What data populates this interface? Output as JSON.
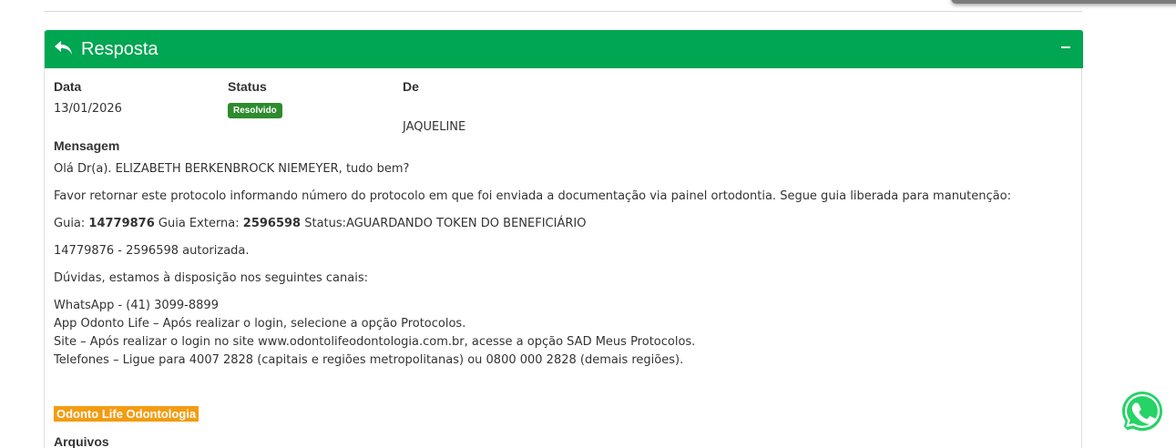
{
  "panel": {
    "title": "Resposta",
    "collapse_label": "−"
  },
  "fields": {
    "date_label": "Data",
    "date_value": "13/01/2026",
    "status_label": "Status",
    "status_value": "Resolvido",
    "from_label": "De",
    "from_value": "JAQUELINE"
  },
  "message": {
    "label": "Mensagem",
    "greeting": "Olá Dr(a). ELIZABETH BERKENBROCK NIEMEYER, tudo bem?",
    "request": "Favor retornar este protocolo informando número do protocolo em que foi enviada a documentação via painel ortodontia. Segue guia liberada para manutenção:",
    "guide_prefix": "Guia: ",
    "guide_number": "14779876",
    "external_prefix": " Guia Externa: ",
    "external_number": "2596598",
    "status_text": " Status:AGUARDANDO TOKEN DO BENEFICIÁRIO",
    "authorized": "14779876 - 2596598 autorizada.",
    "doubts": "Dúvidas, estamos à disposição nos seguintes canais:",
    "whatsapp_line": "WhatsApp - (41) 3099-8899",
    "app_line": "App Odonto Life – Após realizar o login, selecione a opção Protocolos.",
    "site_line": "Site – Após realizar o login no site www.odontolifeodontologia.com.br, acesse a opção SAD Meus Protocolos.",
    "phone_line": "Telefones – Ligue para 4007 2828 (capitais e regiões metropolitanas) ou 0800 000 2828 (demais regiões).",
    "signature": "Odonto Life Odontologia"
  },
  "attachments": {
    "label": "Arquivos"
  },
  "colors": {
    "header_green": "#00a651",
    "badge_green": "#2e8b2e",
    "signature_orange": "#f39c12",
    "whatsapp_green": "#25d366"
  },
  "icons": {
    "header": "reply-icon",
    "collapse": "minus-icon",
    "floating": "whatsapp-icon"
  }
}
